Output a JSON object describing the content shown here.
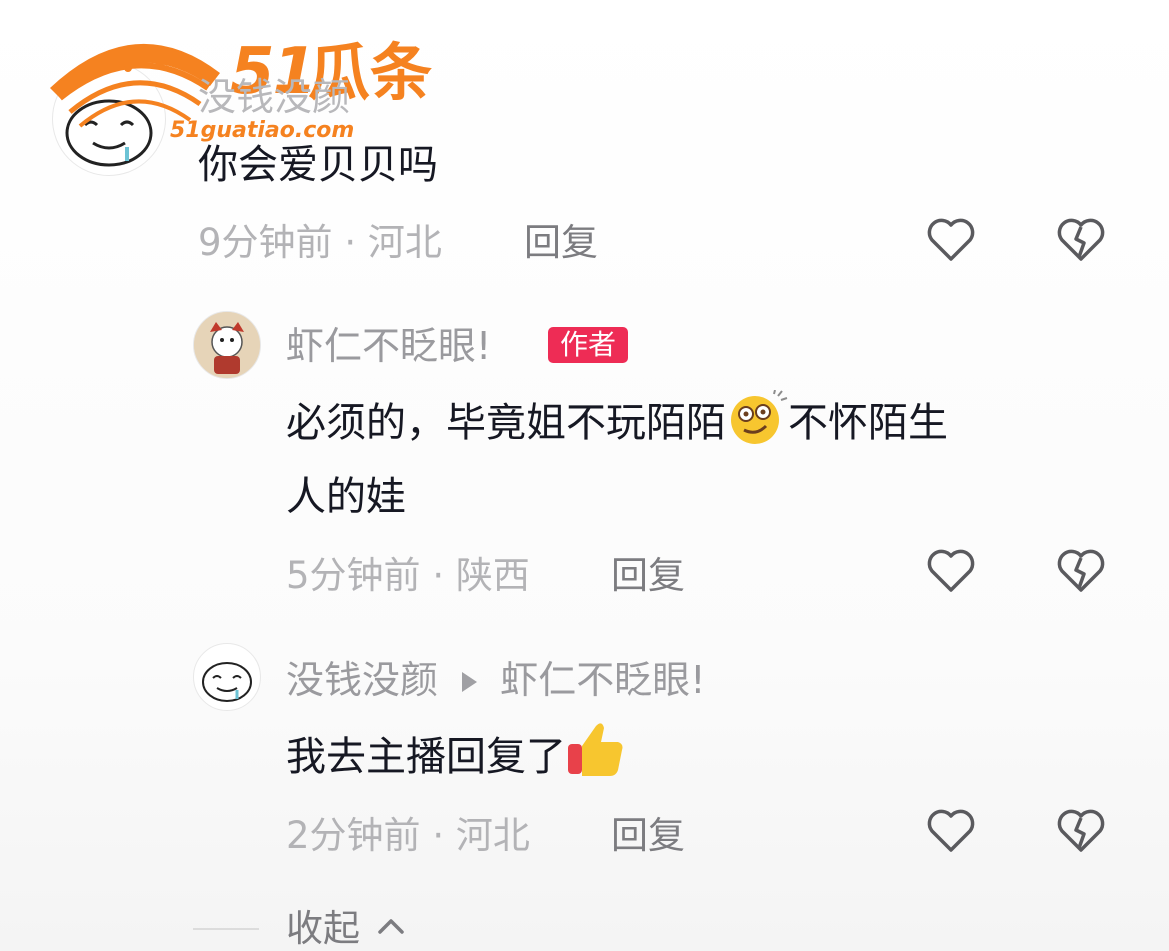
{
  "watermark": {
    "brand_number": "51",
    "brand_name": "瓜条",
    "url": "51guatiao.com",
    "color": "#f58220"
  },
  "comments": [
    {
      "username": "没钱没颜",
      "content": "你会爱贝贝吗",
      "time": "9分钟前",
      "location": "河北",
      "reply_label": "回复",
      "avatar": "smiling-blob-avatar"
    }
  ],
  "replies": [
    {
      "username": "虾仁不眨眼!",
      "badge": "作者",
      "content_line1_a": "必须的，毕竟姐不玩陌陌",
      "content_line1_b": "不怀陌生",
      "content_line2": "人的娃",
      "emoji": "dazed-face-emoji",
      "time": "5分钟前",
      "location": "陕西",
      "reply_label": "回复",
      "avatar": "cartoon-dog-avatar"
    },
    {
      "username": "没钱没颜",
      "reply_to": "虾仁不眨眼!",
      "content": "我去主播回复了",
      "emoji": "thumbs-up-emoji",
      "time": "2分钟前",
      "location": "河北",
      "reply_label": "回复",
      "avatar": "smiling-blob-avatar"
    }
  ],
  "collapse_label": "收起",
  "icons": {
    "like": "heart-outline-icon",
    "dislike": "broken-heart-icon",
    "reply_arrow": "triangle-right-icon",
    "collapse": "chevron-up-icon"
  },
  "colors": {
    "badge_bg": "#ee2c55",
    "text_primary": "#161823",
    "text_secondary": "#9a9a9e"
  }
}
